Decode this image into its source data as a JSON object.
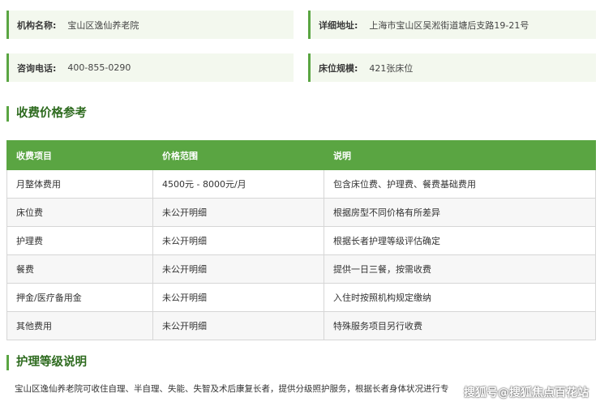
{
  "info": {
    "name": {
      "label": "机构名称:",
      "value": "宝山区逸仙养老院"
    },
    "address": {
      "label": "详细地址:",
      "value": "上海市宝山区吴淞街道塘后支路19-21号"
    },
    "phone": {
      "label": "咨询电话:",
      "value": "400-855-0290"
    },
    "beds": {
      "label": "床位规模:",
      "value": "421张床位"
    }
  },
  "price_section": {
    "title": "收费价格参考"
  },
  "price_table": {
    "headers": [
      "收费项目",
      "价格范围",
      "说明"
    ],
    "rows": [
      [
        "月整体费用",
        "4500元 - 8000元/月",
        "包含床位费、护理费、餐费基础费用"
      ],
      [
        "床位费",
        "未公开明细",
        "根据房型不同价格有所差异"
      ],
      [
        "护理费",
        "未公开明细",
        "根据长者护理等级评估确定"
      ],
      [
        "餐费",
        "未公开明细",
        "提供一日三餐，按需收费"
      ],
      [
        "押金/医疗备用金",
        "未公开明细",
        "入住时按照机构规定缴纳"
      ],
      [
        "其他费用",
        "未公开明细",
        "特殊服务项目另行收费"
      ]
    ]
  },
  "care_section": {
    "title": "护理等级说明",
    "text": "宝山区逸仙养老院可收住自理、半自理、失能、失智及术后康复长者，提供分级照护服务，根据长者身体状况进行专"
  },
  "watermark": "搜狐号@搜狐焦点百花站"
}
